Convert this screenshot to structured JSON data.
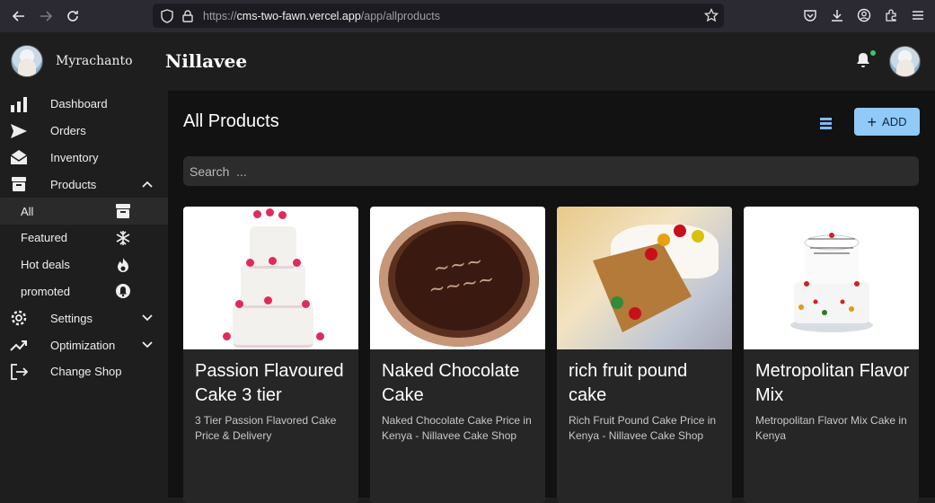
{
  "browser": {
    "url_prefix": "https://",
    "url_host": "cms-two-fawn.vercel.app",
    "url_path": "/app/allproducts"
  },
  "user": {
    "name": "Myrachanto"
  },
  "app": {
    "title": "Nillavee"
  },
  "sidebar": {
    "items": [
      {
        "label": "Dashboard",
        "icon": "bar-chart-icon"
      },
      {
        "label": "Orders",
        "icon": "send-icon"
      },
      {
        "label": "Inventory",
        "icon": "envelope-open-icon"
      },
      {
        "label": "Products",
        "icon": "archive-icon",
        "expanded": true
      },
      {
        "label": "All",
        "icon": "archive-icon",
        "active": true
      },
      {
        "label": "Featured",
        "icon": "snowflake-icon"
      },
      {
        "label": "Hot deals",
        "icon": "flame-icon"
      },
      {
        "label": "promoted",
        "icon": "notification-icon"
      },
      {
        "label": "Settings",
        "icon": "gear-icon"
      },
      {
        "label": "Optimization",
        "icon": "trending-up-icon"
      },
      {
        "label": "Change Shop",
        "icon": "logout-icon"
      }
    ]
  },
  "main": {
    "title": "All Products",
    "add_label": "ADD",
    "search_placeholder": "Search  ..."
  },
  "products": [
    {
      "title": "Passion Flavoured Cake 3 tier",
      "desc": "3 Tier Passion Flavored Cake Price & Delivery"
    },
    {
      "title": "Naked Chocolate Cake",
      "desc": "Naked Chocolate Cake Price in Kenya - Nillavee Cake Shop"
    },
    {
      "title": "rich fruit pound cake",
      "desc": "Rich Fruit Pound Cake Price in Kenya - Nillavee Cake Shop"
    },
    {
      "title": "Metropolitan Flavor Mix",
      "desc": "Metropolitan Flavor Mix Cake in Kenya"
    }
  ],
  "colors": {
    "accent": "#90caf9",
    "background": "#121212",
    "sidebar": "#1e1e1e",
    "card": "#262626"
  }
}
